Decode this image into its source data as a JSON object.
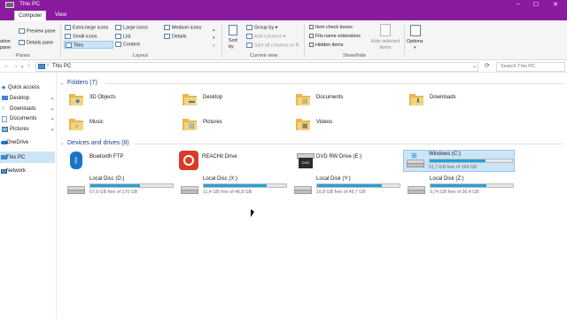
{
  "window": {
    "title": "This PC"
  },
  "tabs": [
    "Computer",
    "View"
  ],
  "ribbon": {
    "panes": {
      "pane_label": "Panes",
      "navigation_pane": "ation\npane",
      "preview_pane": "Preview pane",
      "details_pane": "Details pane"
    },
    "layout": {
      "label": "Layout",
      "items": [
        "Extra large icons",
        "Large icons",
        "Medium icons",
        "Small icons",
        "List",
        "Details",
        "Tiles",
        "Content"
      ]
    },
    "current_view": {
      "label": "Current view",
      "sort_by": "Sort\nby",
      "group_by": "Group by",
      "add_columns": "Add columns",
      "size_columns": "Size all columns to fit"
    },
    "show_hide": {
      "label": "Show/hide",
      "item_check_boxes": "Item check boxes",
      "file_name_extensions": "File name extensions",
      "hidden_items": "Hidden items",
      "hide_selected": "Hide selected\nitems"
    },
    "options": {
      "label": "Options"
    }
  },
  "address": {
    "path": "This PC",
    "search_placeholder": "Search This PC"
  },
  "sidebar": [
    {
      "label": "Quick access",
      "pinned": false
    },
    {
      "label": "Desktop",
      "pinned": true
    },
    {
      "label": "Downloads",
      "pinned": true
    },
    {
      "label": "Documents",
      "pinned": true
    },
    {
      "label": "Pictures",
      "pinned": true
    },
    {
      "label": "OneDrive",
      "pinned": false
    },
    {
      "label": "This PC",
      "pinned": false
    },
    {
      "label": "Network",
      "pinned": false
    }
  ],
  "folders_section": "Folders (7)",
  "folders": [
    {
      "name": "3D Objects",
      "icon": "cube-icon"
    },
    {
      "name": "Desktop",
      "icon": "desktop-icon"
    },
    {
      "name": "Documents",
      "icon": "document-icon"
    },
    {
      "name": "Downloads",
      "icon": "download-arrow-icon"
    },
    {
      "name": "Music",
      "icon": "music-note-icon"
    },
    {
      "name": "Pictures",
      "icon": "picture-icon"
    },
    {
      "name": "Videos",
      "icon": "film-icon"
    }
  ],
  "devices_section": "Devices and drives (8)",
  "devices": [
    {
      "name": "Bluetooth FTP",
      "icon": "bluetooth-icon"
    },
    {
      "name": "REACHit Drive",
      "icon": "reachit-icon"
    },
    {
      "name": "DVD RW Drive (E:)",
      "icon": "dvd-icon"
    },
    {
      "name": "Windows (C:)",
      "free": "51,7 GB free of 164 GB",
      "used_fraction": 0.68,
      "icon": "windows-drive-icon"
    },
    {
      "name": "Local Disc (D:)",
      "free": "67,9 GB free of 170 GB",
      "used_fraction": 0.6,
      "icon": "hard-drive-icon"
    },
    {
      "name": "Local Disc (X:)",
      "free": "11,4 GB free of 46,8 GB",
      "used_fraction": 0.76,
      "icon": "hard-drive-icon"
    },
    {
      "name": "Local Disk (Y:)",
      "free": "10,8 GB free of 49,7 GB",
      "used_fraction": 0.78,
      "icon": "hard-drive-icon"
    },
    {
      "name": "Local Disk (Z:)",
      "free": "9,74 GB free of 30,4 GB",
      "used_fraction": 0.68,
      "icon": "hard-drive-icon"
    }
  ],
  "colors": {
    "accent": "#8a1b9e",
    "selection": "#cce4f7",
    "bar_fill": "#26a0da",
    "folder": "#f6d37a"
  }
}
